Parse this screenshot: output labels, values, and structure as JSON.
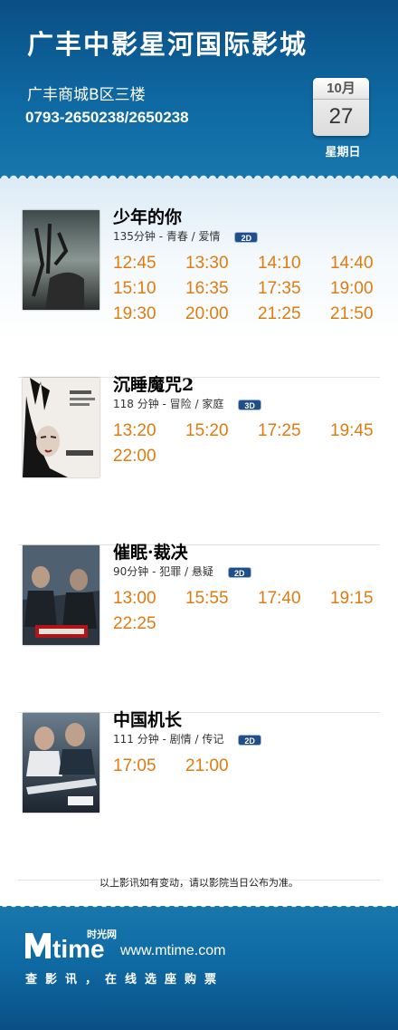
{
  "header": {
    "cinema_name": "广丰中影星河国际影城",
    "address": "广丰商城B区三楼",
    "phone": "0793-2650238/2650238",
    "date": {
      "month": "10月",
      "day": "27",
      "weekday": "星期日"
    }
  },
  "movies": [
    {
      "title": "少年的你",
      "info": "135分钟 - 青春 / 爱情",
      "format": "2D",
      "times": [
        "12:45",
        "13:30",
        "14:10",
        "14:40",
        "15:10",
        "16:35",
        "17:35",
        "19:00",
        "19:30",
        "20:00",
        "21:25",
        "21:50"
      ]
    },
    {
      "title": "沉睡魔咒2",
      "info": "118 分钟 - 冒险 / 家庭",
      "format": "3D",
      "times": [
        "13:20",
        "15:20",
        "17:25",
        "19:45",
        "22:00"
      ]
    },
    {
      "title": "催眠·裁决",
      "info": "90分钟 - 犯罪 / 悬疑",
      "format": "2D",
      "times": [
        "13:00",
        "15:55",
        "17:40",
        "19:15",
        "22:25"
      ]
    },
    {
      "title": "中国机长",
      "info": "111 分钟 - 剧情 / 传记",
      "format": "2D",
      "times": [
        "17:05",
        "21:00"
      ]
    }
  ],
  "notice": "以上影讯如有变动，请以影院当日公布为准。",
  "footer": {
    "logo_text": "Mtime",
    "logo_cn": "时光网",
    "site": "www.mtime.com",
    "slogan": "查影讯，在线选座购票"
  },
  "colors": {
    "header_blue": "#0f6aa3",
    "time_orange": "#e07b10"
  }
}
